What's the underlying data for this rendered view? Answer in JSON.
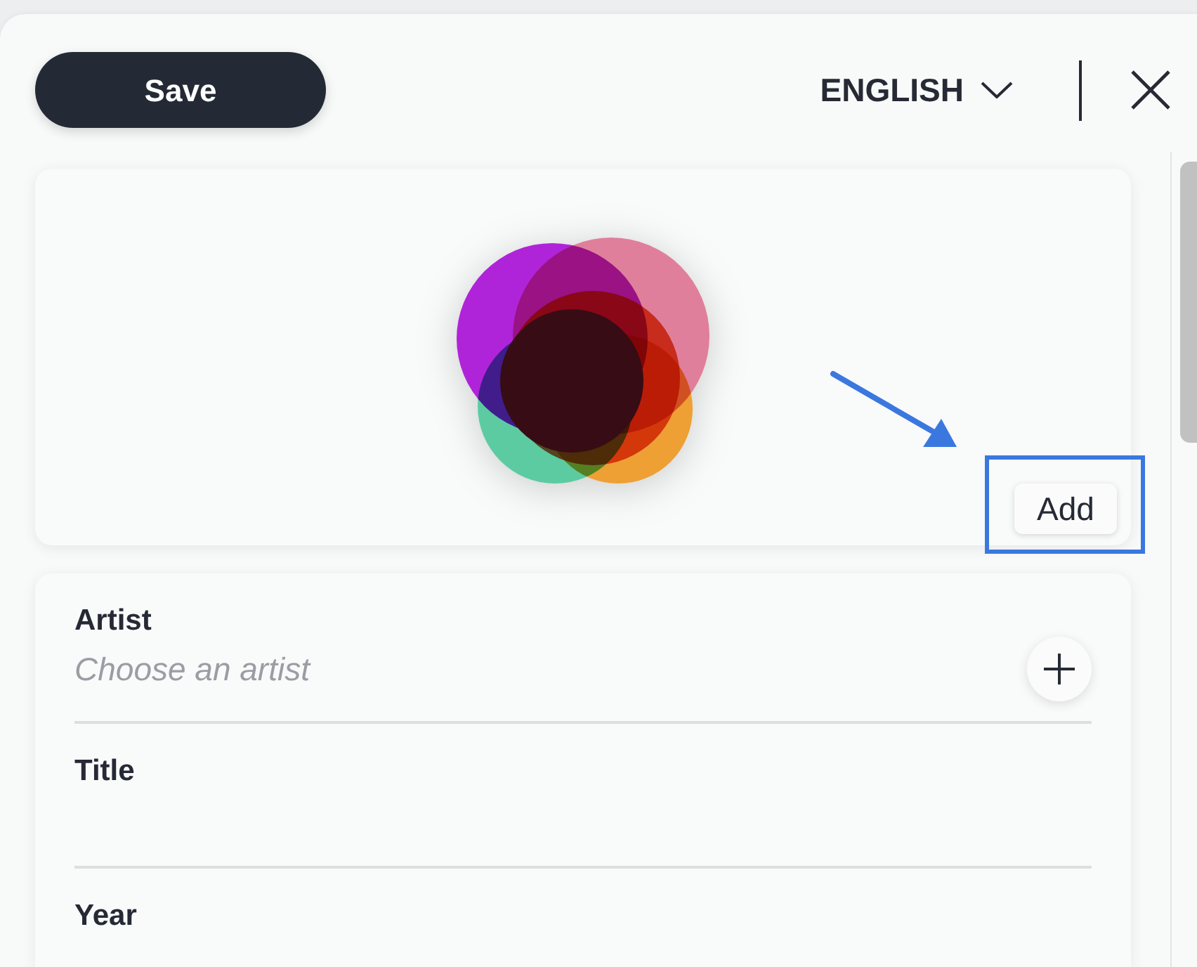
{
  "header": {
    "save_button": "Save",
    "language": "ENGLISH"
  },
  "cover_card": {
    "add_button": "Add",
    "highlighted": true
  },
  "fields": [
    {
      "label": "Artist",
      "kind": "picker",
      "placeholder": "Choose an artist"
    },
    {
      "label": "Title",
      "kind": "text"
    },
    {
      "label": "Year",
      "kind": "label"
    }
  ]
}
